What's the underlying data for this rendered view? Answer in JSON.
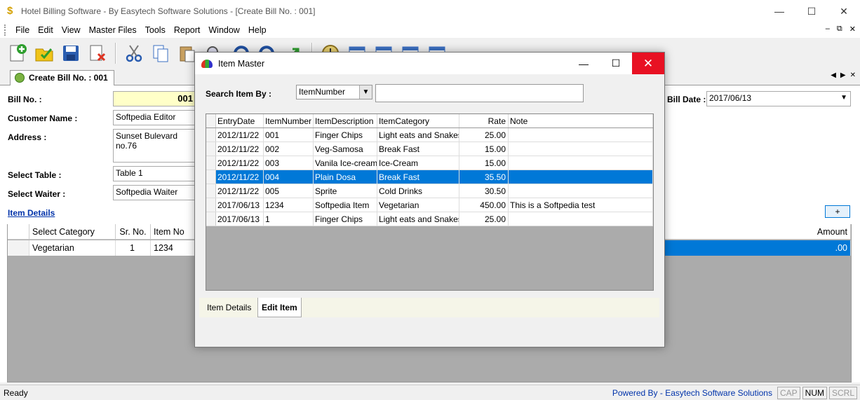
{
  "window": {
    "title": "Hotel Billing Software - By Easytech Software Solutions - [Create Bill No. : 001]",
    "minimize": "—",
    "maximize": "☐",
    "close": "✕"
  },
  "menu": [
    "File",
    "Edit",
    "View",
    "Master Files",
    "Tools",
    "Report",
    "Window",
    "Help"
  ],
  "mdi": {
    "min": "–",
    "restore": "⧉",
    "close": "✕"
  },
  "tab": {
    "label": "Create Bill No. : 001"
  },
  "tabnav": {
    "prev": "◀",
    "next": "▶",
    "close": "✕"
  },
  "form": {
    "bill_no_label": "Bill No. :",
    "bill_no_value": "001",
    "customer_label": "Customer Name :",
    "customer_value": "Softpedia Editor",
    "address_label": "Address :",
    "address_value": "Sunset Bulevard no.76",
    "table_label": "Select Table :",
    "table_value": "Table 1",
    "waiter_label": "Select Waiter :",
    "waiter_value": "Softpedia Waiter",
    "bill_date_label": "Bill Date :",
    "bill_date_value": "2017/06/13",
    "item_details_link": "Item Details",
    "add_button": "+"
  },
  "item_grid": {
    "headers": [
      "Select Category",
      "Sr. No.",
      "Item No",
      "Amount"
    ],
    "row": {
      "category": "Vegetarian",
      "sr_no": "1",
      "item_no": "1234",
      "amount": ".00"
    }
  },
  "status": {
    "ready": "Ready",
    "powered_by": "Powered By - Easytech Software Solutions",
    "cap": "CAP",
    "num": "NUM",
    "scrl": "SCRL"
  },
  "dialog": {
    "title": "Item Master",
    "search_label": "Search Item By :",
    "search_field": "ItemNumber",
    "search_value": "",
    "columns": [
      "EntryDate",
      "ItemNumber",
      "ItemDescription",
      "ItemCategory",
      "Rate",
      "Note"
    ],
    "rows": [
      [
        "2012/11/22",
        "001",
        "Finger Chips",
        "Light eats and Snakes",
        "25.00",
        ""
      ],
      [
        "2012/11/22",
        "002",
        "Veg-Samosa",
        "Break Fast",
        "15.00",
        ""
      ],
      [
        "2012/11/22",
        "003",
        "Vanila Ice-cream",
        "Ice-Cream",
        "15.00",
        ""
      ],
      [
        "2012/11/22",
        "004",
        "Plain Dosa",
        "Break Fast",
        "35.50",
        ""
      ],
      [
        "2012/11/22",
        "005",
        "Sprite",
        "Cold Drinks",
        "30.50",
        ""
      ],
      [
        "2017/06/13",
        "1234",
        "Softpedia Item",
        "Vegetarian",
        "450.00",
        "This is a Softpedia test"
      ],
      [
        "2017/06/13",
        "1",
        "Finger Chips",
        "Light eats and Snakes",
        "25.00",
        ""
      ]
    ],
    "tabs": [
      "Item Details",
      "Edit Item"
    ]
  }
}
